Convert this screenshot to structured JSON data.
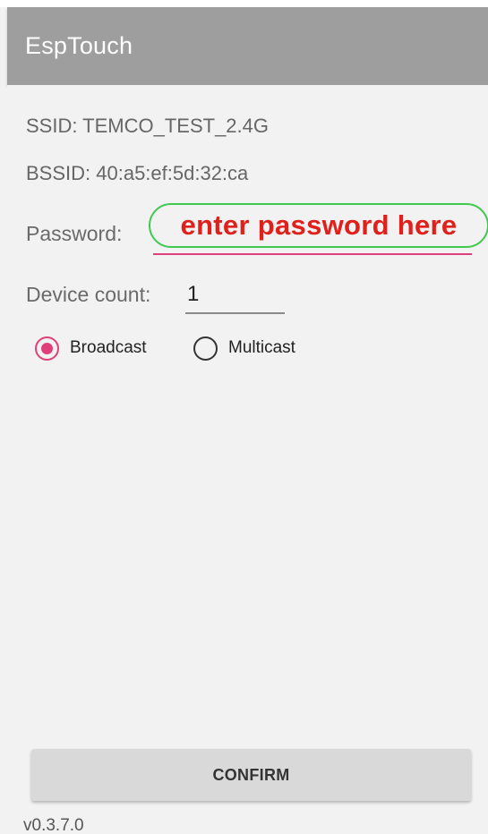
{
  "app_bar": {
    "title": "EspTouch"
  },
  "info": {
    "ssid": "SSID: TEMCO_TEST_2.4G",
    "bssid": "BSSID: 40:a5:ef:5d:32:ca"
  },
  "password": {
    "label": "Password:",
    "value": "",
    "annotation": "enter password here"
  },
  "device_count": {
    "label": "Device count:",
    "value": "1"
  },
  "mode": {
    "options": [
      {
        "label": "Broadcast",
        "selected": true
      },
      {
        "label": "Multicast",
        "selected": false
      }
    ]
  },
  "confirm_button": {
    "label": "CONFIRM"
  },
  "version": "v0.3.7.0",
  "colors": {
    "app_bar": "#9e9e9e",
    "accent": "#e0407a",
    "annotation_text": "#e0201b",
    "annotation_border": "#3fc94f",
    "background": "#f2f2f2"
  }
}
